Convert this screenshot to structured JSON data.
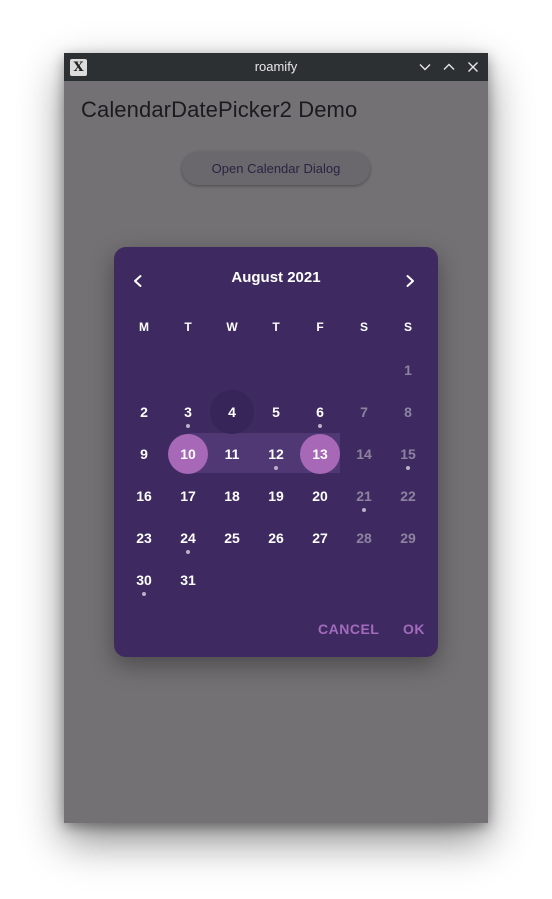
{
  "window": {
    "title": "roamify",
    "app_icon": "X"
  },
  "titlebar_icons": [
    "app-icon",
    "minimize-chevron-down-icon",
    "maximize-chevron-up-icon",
    "close-icon"
  ],
  "app": {
    "title": "CalendarDatePicker2 Demo",
    "open_button_label": "Open Calendar Dialog"
  },
  "dialog": {
    "month_label": "August 2021",
    "weekdays": [
      "M",
      "T",
      "W",
      "T",
      "F",
      "S",
      "S"
    ],
    "cancel_label": "CANCEL",
    "ok_label": "OK",
    "range_start": "10",
    "range_end": "13",
    "days": [
      {
        "label": "1"
      },
      {
        "label": "2"
      },
      {
        "label": "3"
      },
      {
        "label": "4"
      },
      {
        "label": "5"
      },
      {
        "label": "6"
      },
      {
        "label": "7"
      },
      {
        "label": "8"
      },
      {
        "label": "9"
      },
      {
        "label": "10"
      },
      {
        "label": "11"
      },
      {
        "label": "12"
      },
      {
        "label": "13"
      },
      {
        "label": "14"
      },
      {
        "label": "15"
      },
      {
        "label": "16"
      },
      {
        "label": "17"
      },
      {
        "label": "18"
      },
      {
        "label": "19"
      },
      {
        "label": "20"
      },
      {
        "label": "21"
      },
      {
        "label": "22"
      },
      {
        "label": "23"
      },
      {
        "label": "24"
      },
      {
        "label": "25"
      },
      {
        "label": "26"
      },
      {
        "label": "27"
      },
      {
        "label": "28"
      },
      {
        "label": "29"
      },
      {
        "label": "30"
      },
      {
        "label": "31"
      }
    ],
    "days_with_dots": [
      "3",
      "6",
      "12",
      "15",
      "21",
      "24",
      "30"
    ]
  },
  "colors": {
    "dialog_bg": "#3e2a60",
    "selected": "#a768b8",
    "range_band": "#4f3874",
    "action": "#a26bbd",
    "overlay": "#737173"
  }
}
